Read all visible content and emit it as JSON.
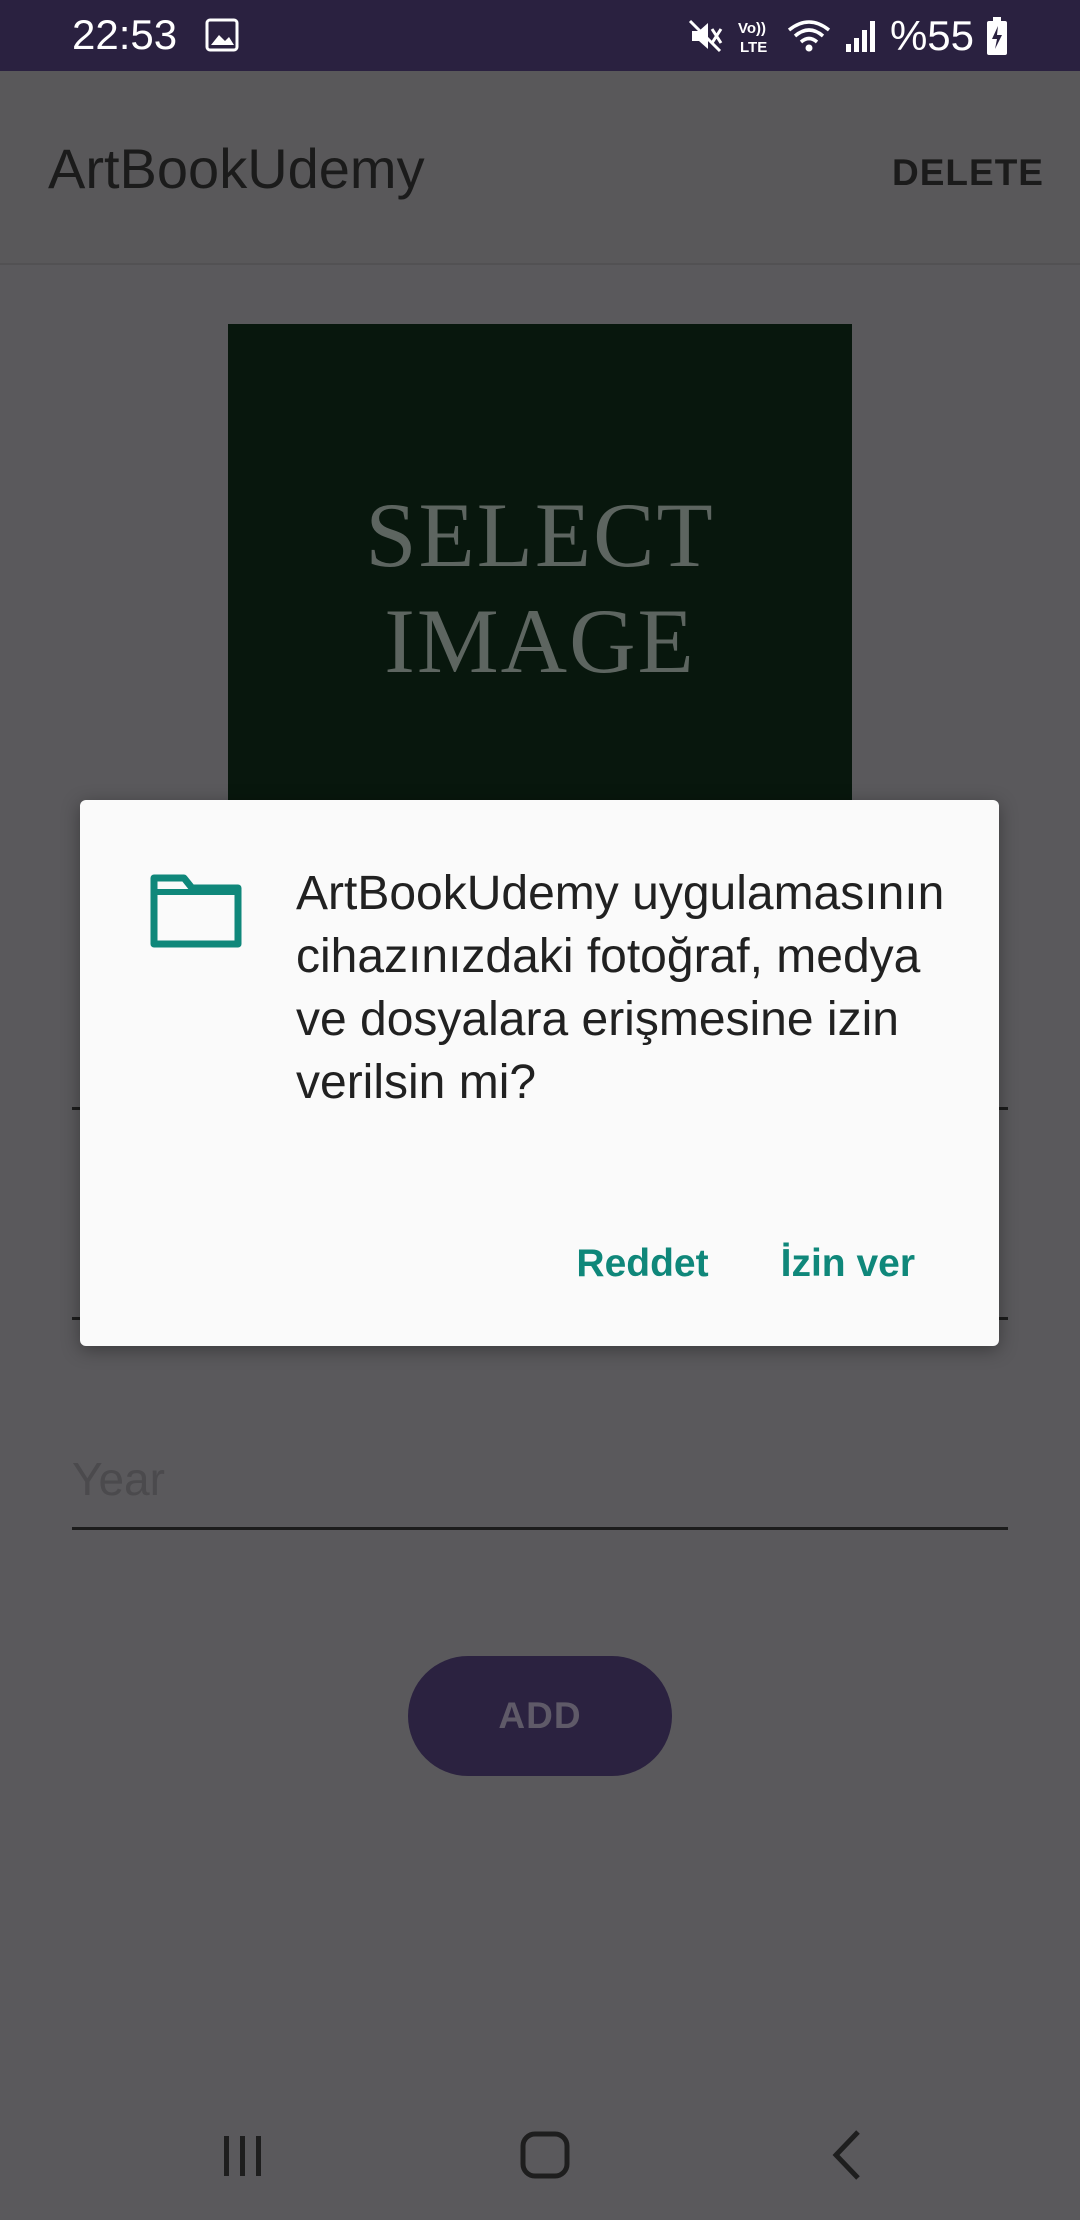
{
  "status_bar": {
    "time": "22:53",
    "battery": "%55",
    "icons": [
      "image-icon",
      "mute-icon",
      "volte-icon",
      "wifi-icon",
      "signal-icon",
      "battery-charging-icon"
    ]
  },
  "app_bar": {
    "title": "ArtBookUdemy",
    "delete_label": "DELETE"
  },
  "form": {
    "image_placeholder": "SELECT\nIMAGE",
    "year_hint": "Year",
    "add_label": "ADD"
  },
  "dialog": {
    "icon": "folder-icon",
    "message": "ArtBookUdemy uygulamasının cihazınızdaki fotoğraf, medya ve dosyalara erişmesine izin verilsin mi?",
    "deny_label": "Reddet",
    "allow_label": "İzin ver",
    "accent_color": "#0f877a"
  },
  "nav_bar": {
    "icons": [
      "recents-icon",
      "home-icon",
      "back-icon"
    ]
  }
}
